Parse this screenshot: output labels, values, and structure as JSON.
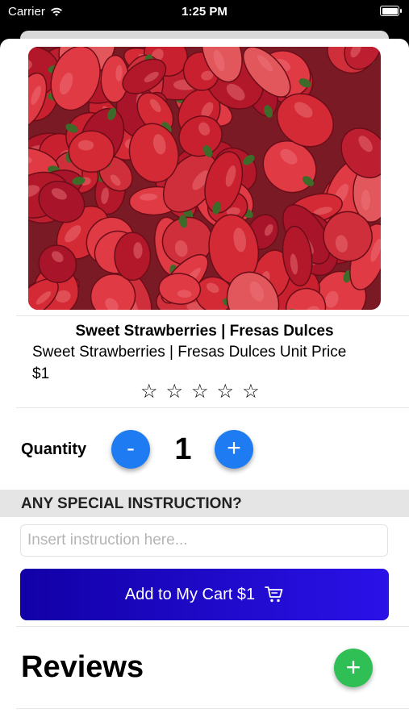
{
  "status_bar": {
    "carrier": "Carrier",
    "time": "1:25 PM"
  },
  "product": {
    "image_alt": "strawberries",
    "title": "Sweet Strawberries | Fresas Dulces",
    "subtitle": "Sweet Strawberries | Fresas Dulces Unit Price",
    "price": "$1",
    "rating": {
      "value": 0,
      "max": 5,
      "star_char": "☆"
    }
  },
  "quantity": {
    "label": "Quantity",
    "value": "1",
    "minus": "-",
    "plus": "+"
  },
  "instructions": {
    "header": "ANY SPECIAL INSTRUCTION?",
    "placeholder": "Insert instruction here..."
  },
  "cart": {
    "label": "Add to My Cart $1"
  },
  "reviews": {
    "title": "Reviews",
    "add": "+"
  },
  "colors": {
    "accent_blue": "#1e7bf2",
    "cart_start": "#1200a6",
    "cart_end": "#2a12e8",
    "review_green": "#2fbf55"
  }
}
